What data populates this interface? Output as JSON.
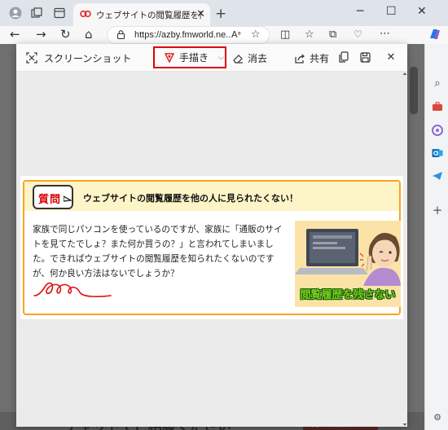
{
  "browser": {
    "tab_title": "ウェブサイトの閲覧履歴を他の人に見",
    "url": "https://azby.fmworld.ne..."
  },
  "screenshot_panel": {
    "title": "スクリーンショット",
    "draw_label": "手描き",
    "erase_label": "消去",
    "share_label": "共有"
  },
  "capture": {
    "badge": "質問",
    "heading": "ウェブサイトの閲覧履歴を他の人に見られたくない！",
    "body": "家族で同じパソコンを使っているのですが、家族に「通販のサイトを見てたでしょ？また何か買うの？」と言われてしまいました。できればウェブサイトの閲覧履歴を知られたくないのですが、何か良い方法はないでしょうか？",
    "illustration_caption": "閲覧履歴を残さない"
  },
  "background_page": {
    "bottom_text": "チャットでご相談ください",
    "bottom_badge": "利用無料"
  },
  "colors": {
    "highlight_border": "#e00000",
    "frame_orange": "#f5a51d",
    "badge_red": "#d90000",
    "caption_green": "#7acb1f"
  },
  "icons": [
    "profile-icon",
    "workspaces-icon",
    "tab-actions-icon",
    "edge-tab-icon",
    "back-icon",
    "forward-icon",
    "refresh-icon",
    "home-icon",
    "lock-icon",
    "read-aloud-icon",
    "favorite-icon",
    "split-screen-icon",
    "favorites-icon",
    "collections-icon",
    "browser-essentials-icon",
    "more-icon",
    "copilot-icon",
    "search-icon",
    "tools-icon",
    "games-icon",
    "outlook-icon",
    "telegram-icon",
    "add-icon"
  ]
}
